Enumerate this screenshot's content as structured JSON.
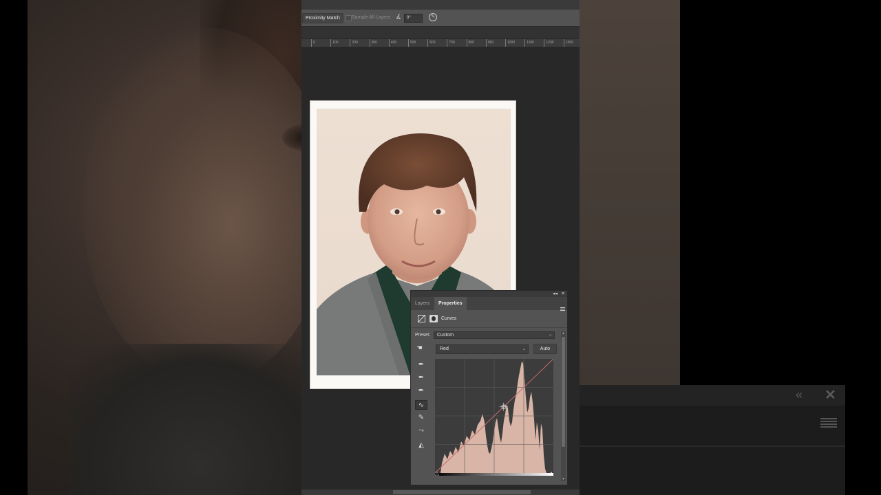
{
  "options_bar": {
    "proximity_match_label": "Proximity Match",
    "sample_all_layers_label": "Sample All Layers",
    "angle_value": "0°"
  },
  "ruler": {
    "ticks": [
      "0",
      "100",
      "200",
      "300",
      "400",
      "500",
      "600",
      "700",
      "800",
      "900",
      "1000",
      "1100",
      "1200",
      "1300"
    ]
  },
  "panel": {
    "tabs": [
      {
        "label": "Layers",
        "active": false
      },
      {
        "label": "Properties",
        "active": true
      }
    ],
    "adjustment_title": "Curves",
    "preset_label": "Preset:",
    "preset_value": "Custom",
    "channel_value": "Red",
    "auto_label": "Auto"
  },
  "icons": {
    "panel_collapse": "collapse-double-arrow-icon",
    "panel_close": "close-icon",
    "panel_menu": "menu-icon",
    "curves_adjustment": "curves-icon",
    "mask": "mask-icon",
    "on_image_adjust": "hand-icon",
    "eyedropper_black": "eyedropper-black-icon",
    "eyedropper_gray": "eyedropper-gray-icon",
    "eyedropper_white": "eyedropper-white-icon",
    "edit_points": "curve-point-icon",
    "draw_pencil": "pencil-icon",
    "smooth": "smooth-curve-icon",
    "clipping": "clipping-warning-icon",
    "angle": "angle-icon",
    "pressure": "pressure-icon"
  },
  "colors": {
    "curve_line": "#c46a6a",
    "histogram_fill": "#d9b5a7",
    "panel_bg": "#535353",
    "canvas_bg": "#282828"
  },
  "curve": {
    "channel": "Red",
    "points": [
      [
        0,
        0
      ],
      [
        0.58,
        0.58
      ],
      [
        1,
        1
      ]
    ]
  }
}
